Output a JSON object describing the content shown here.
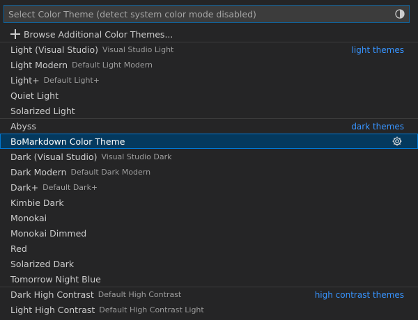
{
  "search": {
    "placeholder": "Select Color Theme (detect system color mode disabled)"
  },
  "browse": {
    "label": "Browse Additional Color Themes..."
  },
  "groups": {
    "light": "light themes",
    "dark": "dark themes",
    "high_contrast": "high contrast themes"
  },
  "themes": [
    {
      "label": "Light (Visual Studio)",
      "desc": "Visual Studio Light"
    },
    {
      "label": "Light Modern",
      "desc": "Default Light Modern"
    },
    {
      "label": "Light+",
      "desc": "Default Light+"
    },
    {
      "label": "Quiet Light",
      "desc": ""
    },
    {
      "label": "Solarized Light",
      "desc": ""
    },
    {
      "label": "Abyss",
      "desc": ""
    },
    {
      "label": "BoMarkdown Color Theme",
      "desc": ""
    },
    {
      "label": "Dark (Visual Studio)",
      "desc": "Visual Studio Dark"
    },
    {
      "label": "Dark Modern",
      "desc": "Default Dark Modern"
    },
    {
      "label": "Dark+",
      "desc": "Default Dark+"
    },
    {
      "label": "Kimbie Dark",
      "desc": ""
    },
    {
      "label": "Monokai",
      "desc": ""
    },
    {
      "label": "Monokai Dimmed",
      "desc": ""
    },
    {
      "label": "Red",
      "desc": ""
    },
    {
      "label": "Solarized Dark",
      "desc": ""
    },
    {
      "label": "Tomorrow Night Blue",
      "desc": ""
    },
    {
      "label": "Dark High Contrast",
      "desc": "Default High Contrast"
    },
    {
      "label": "Light High Contrast",
      "desc": "Default High Contrast Light"
    }
  ],
  "colors": {
    "background": "#252526",
    "accent": "#3794ff",
    "selected_background": "#04395e",
    "focus_border": "#0e639c"
  },
  "icons": {
    "contrast_toggle": "contrast-icon",
    "browse": "plus-icon",
    "configure": "gear-icon"
  }
}
